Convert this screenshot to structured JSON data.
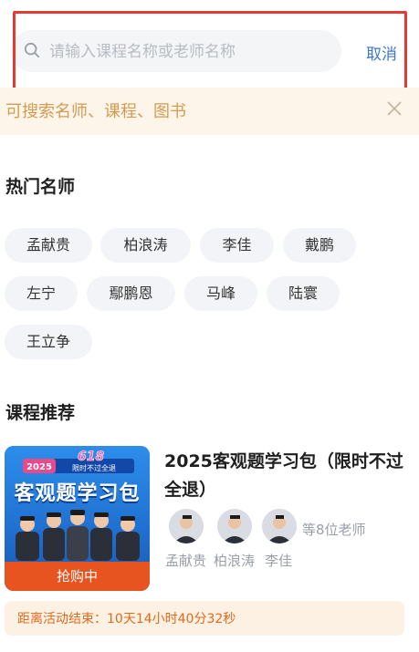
{
  "search": {
    "placeholder": "请输入课程名称或老师名称",
    "cancel_label": "取消"
  },
  "tip": {
    "text": "可搜索名师、课程、图书"
  },
  "hot_teachers": {
    "title": "热门名师",
    "names": [
      "孟献贵",
      "柏浪涛",
      "李佳",
      "戴鹏",
      "左宁",
      "鄢鹏恩",
      "马峰",
      "陆寰",
      "王立争"
    ]
  },
  "recommend": {
    "title": "课程推荐",
    "course": {
      "poster_badge_number": "618",
      "poster_year": "2025",
      "poster_badge_text": "限时不过全退",
      "poster_title": "客观题学习包",
      "buy_tag": "抢购中",
      "title": "2025客观题学习包（限时不过全退）",
      "teachers": [
        "孟献贵",
        "柏浪涛",
        "李佳"
      ],
      "more_teachers": "等8位老师",
      "countdown": "距离活动结束：10天14小时40分32秒"
    }
  },
  "colors": {
    "highlight_border": "#e53935",
    "accent_blue": "#3f77c8",
    "tip_text": "#d39c52",
    "promo_orange": "#e06a1c"
  }
}
